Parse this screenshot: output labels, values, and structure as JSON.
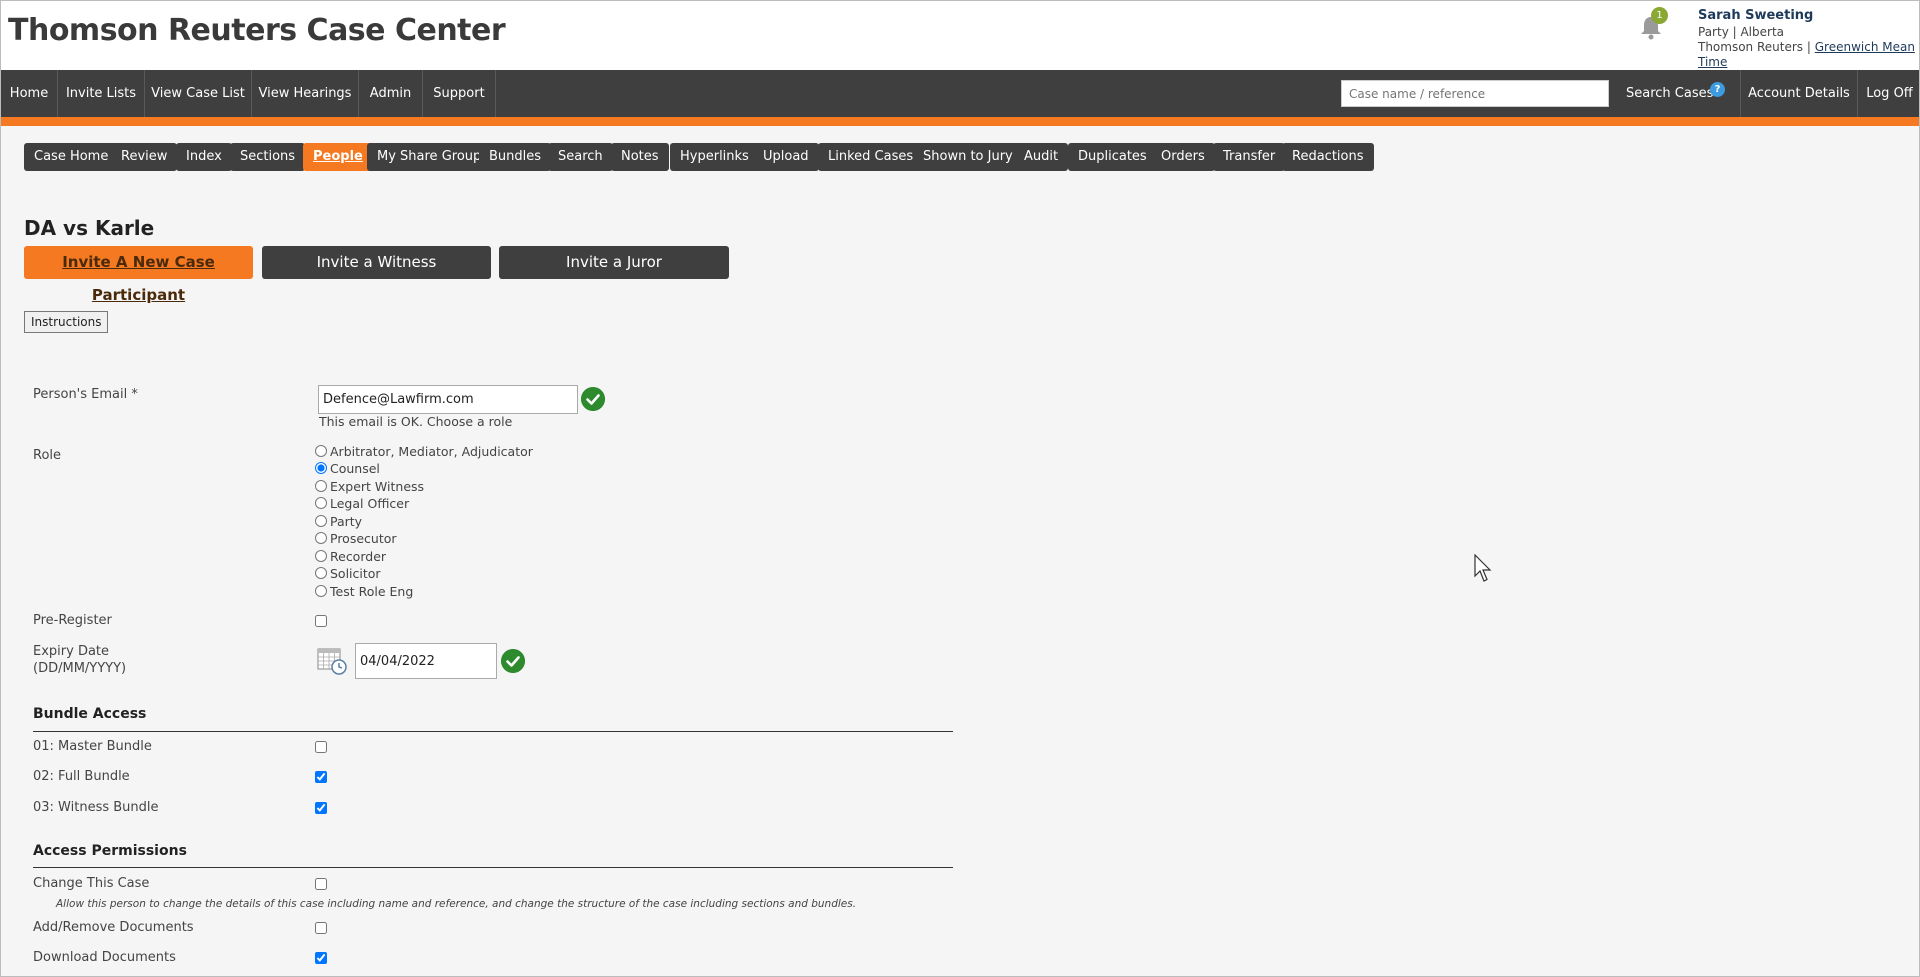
{
  "header": {
    "title": "Thomson Reuters Case Center",
    "notification_count": "1",
    "user": {
      "name": "Sarah Sweeting",
      "line1": "Party | Alberta",
      "org": "Thomson Reuters |",
      "timezone": "Greenwich Mean Time"
    }
  },
  "nav": {
    "items": [
      "Home",
      "Invite Lists",
      "View Case List",
      "View Hearings",
      "Admin",
      "Support"
    ],
    "search_placeholder": "Case name / reference",
    "search_label": "Search Cases",
    "account_details": "Account Details",
    "log_off": "Log Off"
  },
  "case_tabs": [
    "Case Home",
    "Review",
    "Index",
    "Sections",
    "People",
    "My Share Group",
    "Bundles",
    "Search",
    "Notes",
    "Hyperlinks",
    "Upload",
    "Linked Cases",
    "Shown to Jury",
    "Audit",
    "Duplicates",
    "Orders",
    "Transfer",
    "Redactions"
  ],
  "active_case_tab": "People",
  "case_title": "DA vs Karle",
  "invite_buttons": [
    "Invite A New Case Participant",
    "Invite a Witness",
    "Invite a Juror"
  ],
  "instructions_label": "Instructions",
  "form": {
    "email_label": "Person's Email *",
    "email_value": "Defence@Lawfirm.com",
    "email_hint": "This email is OK. Choose a role",
    "role_label": "Role",
    "roles": [
      "Arbitrator, Mediator, Adjudicator",
      "Counsel",
      "Expert Witness",
      "Legal Officer",
      "Party",
      "Prosecutor",
      "Recorder",
      "Solicitor",
      "Test Role Eng"
    ],
    "selected_role": "Counsel",
    "pre_register_label": "Pre-Register",
    "pre_register_checked": false,
    "expiry_label_1": "Expiry Date",
    "expiry_label_2": "(DD/MM/YYYY)",
    "expiry_value": "04/04/2022"
  },
  "bundle_access": {
    "heading": "Bundle Access",
    "items": [
      {
        "label": "01: Master Bundle",
        "checked": false
      },
      {
        "label": "02: Full Bundle",
        "checked": true
      },
      {
        "label": "03: Witness Bundle",
        "checked": true
      }
    ]
  },
  "access_permissions": {
    "heading": "Access Permissions",
    "items": [
      {
        "label": "Change This Case",
        "checked": false
      },
      {
        "label": "Add/Remove Documents",
        "checked": false
      },
      {
        "label": "Download Documents",
        "checked": true
      }
    ],
    "change_case_desc": "Allow this person to change the details of this case including name and reference, and change the structure of the case including sections and bundles."
  },
  "colors": {
    "accent": "#f47920",
    "nav_bg": "#3f3f3f",
    "ok_green": "#2d8a2d"
  }
}
